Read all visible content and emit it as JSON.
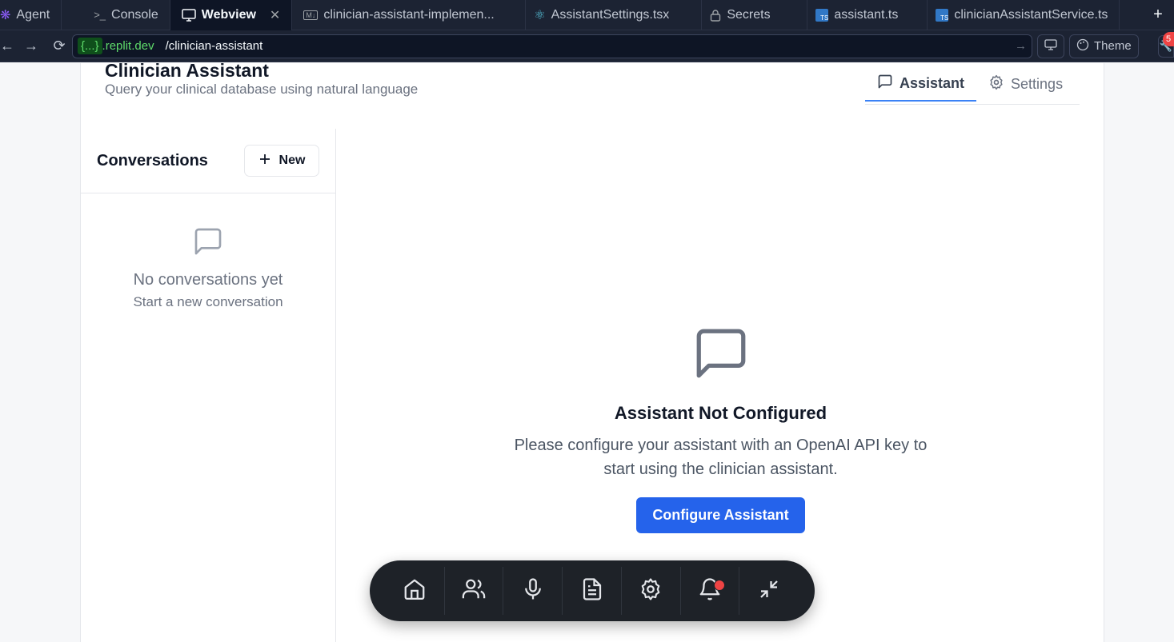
{
  "tabs": [
    {
      "label": "Agent",
      "icon": "agent-icon"
    },
    {
      "label": "Console",
      "icon": "terminal-icon"
    },
    {
      "label": "Webview",
      "icon": "monitor-icon",
      "active": true
    },
    {
      "label": "clinician-assistant-implemen...",
      "icon": "markdown-icon"
    },
    {
      "label": "AssistantSettings.tsx",
      "icon": "react-icon"
    },
    {
      "label": "Secrets",
      "icon": "lock-icon"
    },
    {
      "label": "assistant.ts",
      "icon": "typescript-icon"
    },
    {
      "label": "clinicianAssistantService.ts",
      "icon": "typescript-icon"
    }
  ],
  "urlbar": {
    "domain_prefix": "{...}",
    "domain_suffix": ".replit.dev",
    "path": "/clinician-assistant",
    "theme_label": "Theme",
    "badge_count": "5"
  },
  "page": {
    "title": "Clinician Assistant",
    "subtitle": "Query your clinical database using natural language",
    "tabs": [
      {
        "label": "Assistant",
        "icon": "message-square-icon",
        "active": true
      },
      {
        "label": "Settings",
        "icon": "gear-icon"
      }
    ]
  },
  "sidebar": {
    "title": "Conversations",
    "new_label": "New",
    "empty_title": "No conversations yet",
    "empty_subtitle": "Start a new conversation"
  },
  "main": {
    "title": "Assistant Not Configured",
    "description_line1": "Please configure your assistant with an OpenAI API key to",
    "description_line2": "start using the clinician assistant.",
    "button_label": "Configure Assistant"
  },
  "dock": {
    "items": [
      "home-icon",
      "users-icon",
      "microphone-icon",
      "document-icon",
      "gear-icon",
      "bell-icon",
      "minimize-icon"
    ]
  },
  "colors": {
    "primary": "#2563eb",
    "ide_bg": "#1c2333",
    "notification": "#ef4444"
  }
}
